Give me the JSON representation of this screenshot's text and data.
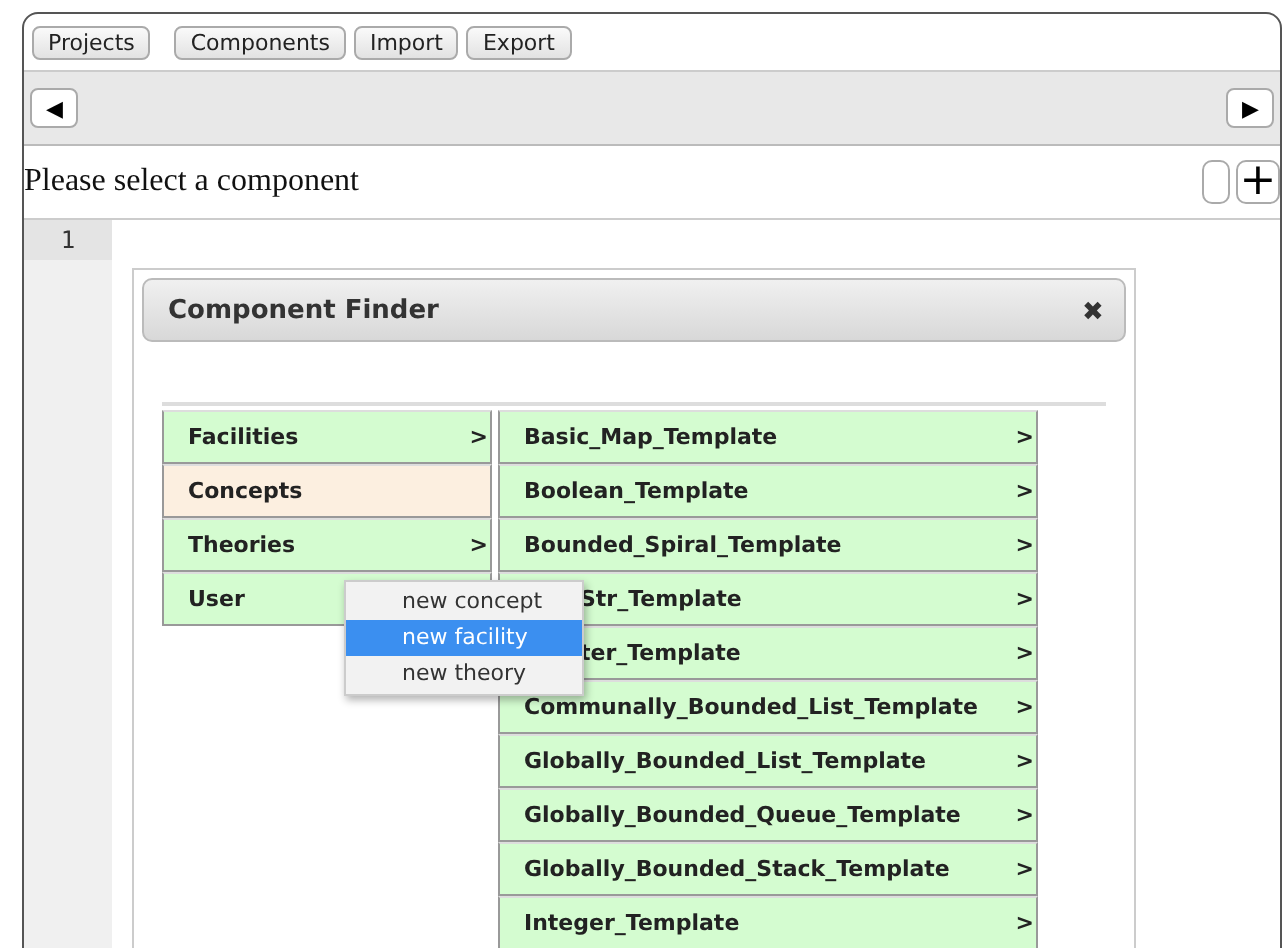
{
  "toolbar": [
    "Projects",
    "Components",
    "Import",
    "Export"
  ],
  "nav": {
    "prev": "◀",
    "next": "▶"
  },
  "prompt": "Please select a component",
  "add_button": "+",
  "editor": {
    "line_numbers": [
      "1"
    ]
  },
  "dialog": {
    "title": "Component Finder",
    "close": "✖",
    "categories": [
      {
        "label": "Facilities",
        "arrow": ">",
        "selected": false
      },
      {
        "label": "Concepts",
        "selected": true
      },
      {
        "label": "Theories",
        "arrow": ">",
        "selected": false
      },
      {
        "label": "User",
        "selected": false
      }
    ],
    "templates": [
      {
        "label": "Basic_Map_Template",
        "arrow": ">",
        "kind": "full"
      },
      {
        "label": "Boolean_Template",
        "arrow": ">",
        "kind": "full"
      },
      {
        "label": "Bounded_Spiral_Template",
        "arrow": ">",
        "kind": "full"
      },
      {
        "label": "Str_Template",
        "arrow": ">",
        "kind": "covered"
      },
      {
        "label": "ter_Template",
        "arrow": ">",
        "kind": "covered"
      },
      {
        "label": "Communally_Bounded_List_Template",
        "arrow": ">",
        "kind": "full"
      },
      {
        "label": "Globally_Bounded_List_Template",
        "arrow": ">",
        "kind": "full"
      },
      {
        "label": "Globally_Bounded_Queue_Template",
        "arrow": ">",
        "kind": "full"
      },
      {
        "label": "Globally_Bounded_Stack_Template",
        "arrow": ">",
        "kind": "full"
      },
      {
        "label": "Integer_Template",
        "arrow": ">",
        "kind": "full"
      }
    ],
    "menu": [
      {
        "label": "new concept",
        "selected": false
      },
      {
        "label": "new facility",
        "selected": true
      },
      {
        "label": "new theory",
        "selected": false
      }
    ]
  }
}
